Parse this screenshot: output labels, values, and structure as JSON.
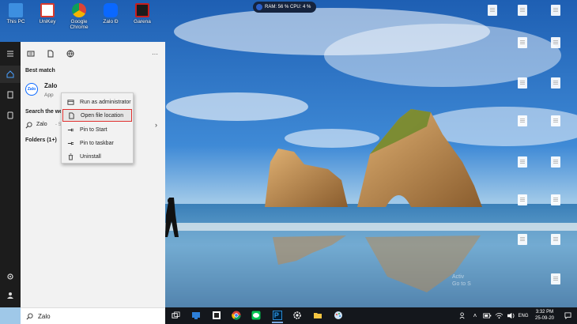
{
  "desktop": {
    "icons": [
      {
        "label": "This PC",
        "icon": "this-pc-icon",
        "color": "#3d8fe0"
      },
      {
        "label": "UniKey",
        "icon": "unikey-icon",
        "color": "#d83a2e"
      },
      {
        "label": "Google Chrome",
        "icon": "chrome-icon",
        "color": "#e8b400"
      },
      {
        "label": "Zalo Đ",
        "icon": "zalo-icon",
        "color": "#0a68ff"
      },
      {
        "label": "Garena",
        "icon": "garena-icon",
        "color": "#c81e1e"
      }
    ],
    "watermark_line1": "Activ",
    "watermark_line2": "Go to S"
  },
  "perf_widget": {
    "text": "RAM: 56 %  CPU: 4 %"
  },
  "search_panel": {
    "best_match_title": "Best match",
    "app_logo_text": "Zalo",
    "app_name": "Zalo",
    "app_type": "App",
    "search_web_title": "Search the we",
    "web_query": "Zalo",
    "web_query_suffix": "- Se",
    "folders_title": "Folders (1+)"
  },
  "context_menu": {
    "items": [
      {
        "label": "Run as administrator",
        "icon": "shield-icon"
      },
      {
        "label": "Open file location",
        "icon": "file-icon"
      },
      {
        "label": "Pin to Start",
        "icon": "pin-icon"
      },
      {
        "label": "Pin to taskbar",
        "icon": "pin-icon"
      },
      {
        "label": "Uninstall",
        "icon": "trash-icon"
      }
    ],
    "highlight_color": "#e0302f"
  },
  "search_box": {
    "value": "Zalo"
  },
  "taskbar": {
    "apps": [
      "task-view-icon",
      "people-icon",
      "sticky-notes-icon",
      "chrome-icon",
      "line-icon",
      "photoshop-icon",
      "settings-icon",
      "file-explorer-icon",
      "paint-icon"
    ],
    "language": "ENG",
    "time": "3:32 PM",
    "date": "25-09-20"
  }
}
